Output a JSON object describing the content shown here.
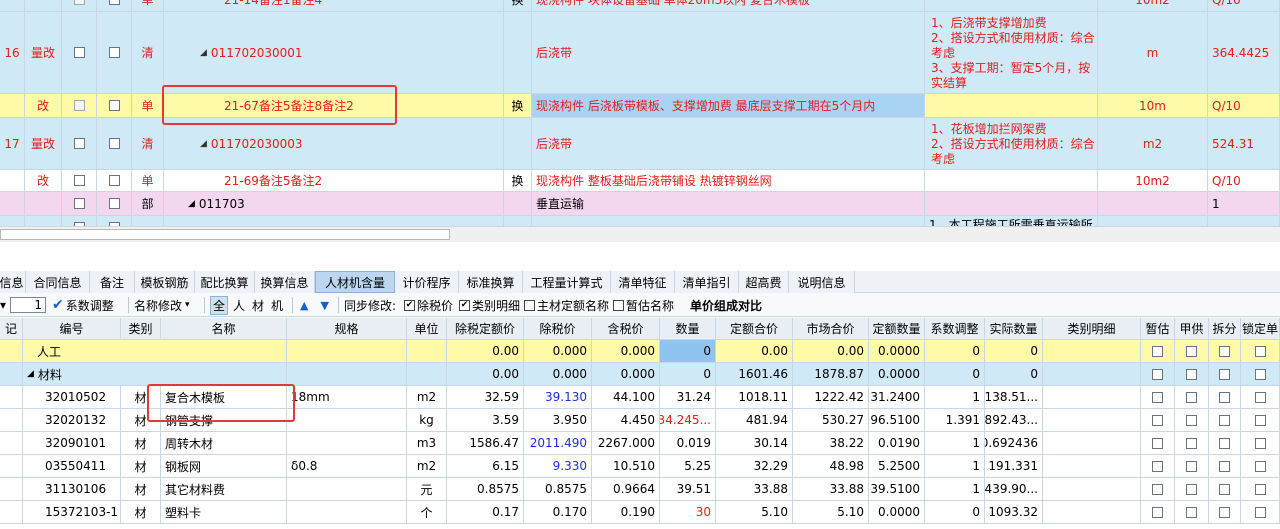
{
  "top_rows": [
    {
      "id": "r0",
      "seq": "",
      "mark": "",
      "cat": "单",
      "code": "21-14备注1备注4",
      "ext": "换",
      "name": "现浇构件 块体设备基础 单体20m3以内 复合木模板",
      "features": "",
      "unit": "10m2",
      "qty": "Q/10"
    },
    {
      "id": "r1",
      "seq": "16",
      "mark": "量改",
      "cat": "清",
      "code": "011702030001",
      "ext": "",
      "name": "后浇带",
      "features": [
        "1、后浇带支撑增加费",
        "2、搭设方式和使用材质：综合考虑",
        "3、支撑工期：暂定5个月，按实结算"
      ],
      "unit": "m",
      "qty": "364.4425"
    },
    {
      "id": "r2",
      "seq": "",
      "mark": "改",
      "cat": "单",
      "code": "21-67备注5备注8备注2",
      "ext": "换",
      "name": "现浇构件 后浇板带模板、支撑增加费 最底层支撑工期在5个月内",
      "features": "",
      "unit": "10m",
      "qty": "Q/10"
    },
    {
      "id": "r3",
      "seq": "17",
      "mark": "量改",
      "cat": "清",
      "code": "011702030003",
      "ext": "",
      "name": "后浇带",
      "features": [
        "1、花板增加拦网架费",
        "2、搭设方式和使用材质：综合考虑"
      ],
      "unit": "m2",
      "qty": "524.31"
    },
    {
      "id": "r4",
      "seq": "",
      "mark": "改",
      "cat": "单",
      "code": "21-69备注5备注2",
      "ext": "换",
      "name": "现浇构件 整板基础后浇带铺设 热镀锌钢丝网",
      "features": "",
      "unit": "10m2",
      "qty": "Q/10"
    },
    {
      "id": "r5",
      "seq": "",
      "mark": "",
      "cat": "部",
      "code": "011703",
      "ext": "",
      "name": "垂直运输",
      "features": "",
      "unit": "",
      "qty": "1"
    },
    {
      "id": "r6",
      "seq": "",
      "mark": "",
      "cat": "",
      "code": "",
      "ext": "",
      "name": "",
      "features": "1、本工程施工所需垂直运输所",
      "unit": "",
      "qty": ""
    }
  ],
  "tabs": [
    "信息",
    "合同信息",
    "备注",
    "模板钢筋",
    "配比换算",
    "换算信息",
    "人材机含量",
    "计价程序",
    "标准换算",
    "工程量计算式",
    "清单特征",
    "清单指引",
    "超高费",
    "说明信息"
  ],
  "active_tab": "人材机含量",
  "toolbar": {
    "spin_value": "1",
    "coef_adjust": "系数调整",
    "name_edit": "名称修改",
    "filters": [
      "全",
      "人",
      "材",
      "机"
    ],
    "sync_label": "同步修改:",
    "checks": [
      {
        "label": "除税价",
        "checked": "✔"
      },
      {
        "label": "类别明细",
        "checked": "✔"
      },
      {
        "label": "主材定额名称",
        "checked": ""
      },
      {
        "label": "暂估名称",
        "checked": ""
      }
    ],
    "compare": "单价组成对比"
  },
  "columns": [
    "记",
    "编号",
    "类别",
    "名称",
    "规格",
    "单位",
    "除税定额价",
    "除税价",
    "含税价",
    "数量",
    "定额合价",
    "市场合价",
    "定额数量",
    "系数调整",
    "实际数量",
    "类别明细",
    "暂估",
    "甲供",
    "拆分",
    "锁定单"
  ],
  "groups": [
    {
      "toggle": "",
      "name": "人工",
      "vals": [
        "0.00",
        "0.000",
        "0.000",
        "0",
        "0.00",
        "0.00",
        "0.0000",
        "0",
        "0"
      ]
    },
    {
      "toggle": "◢",
      "name": "材料",
      "vals": [
        "0.00",
        "0.000",
        "0.000",
        "0",
        "1601.46",
        "1878.87",
        "0.0000",
        "0",
        "0"
      ]
    }
  ],
  "materials": [
    {
      "code": "32010502",
      "type": "材",
      "name": "复合木模板",
      "spec": "18mm",
      "unit": "m2",
      "base": "32.59",
      "price": "39.130",
      "tax": "44.100",
      "qty": "31.24",
      "sum": "1018.11",
      "mkt": "1222.42",
      "dqty": "31.2400",
      "coef": "1",
      "actual": "1138.51..."
    },
    {
      "code": "32020132",
      "type": "材",
      "name": "钢管支撑",
      "spec": "",
      "unit": "kg",
      "base": "3.59",
      "price": "3.950",
      "tax": "4.450",
      "qty": "134.245...",
      "sum": "481.94",
      "mkt": "530.27",
      "dqty": "96.5100",
      "coef": "1.391",
      "actual": "4892.43..."
    },
    {
      "code": "32090101",
      "type": "材",
      "name": "周转木材",
      "spec": "",
      "unit": "m3",
      "base": "1586.47",
      "price": "2011.490",
      "tax": "2267.000",
      "qty": "0.019",
      "sum": "30.14",
      "mkt": "38.22",
      "dqty": "0.0190",
      "coef": "1",
      "actual": "0.692436"
    },
    {
      "code": "03550411",
      "type": "材",
      "name": "钢板网",
      "spec": "δ0.8",
      "unit": "m2",
      "base": "6.15",
      "price": "9.330",
      "tax": "10.510",
      "qty": "5.25",
      "sum": "32.29",
      "mkt": "48.98",
      "dqty": "5.2500",
      "coef": "1",
      "actual": "191.331"
    },
    {
      "code": "31130106",
      "type": "材",
      "name": "其它材料费",
      "spec": "",
      "unit": "元",
      "base": "0.8575",
      "price": "0.8575",
      "tax": "0.9664",
      "qty": "39.51",
      "sum": "33.88",
      "mkt": "33.88",
      "dqty": "39.5100",
      "coef": "1",
      "actual": "1439.90..."
    },
    {
      "code": "15372103-1",
      "type": "材",
      "name": "塑料卡",
      "spec": "",
      "unit": "个",
      "base": "0.17",
      "price": "0.170",
      "tax": "0.190",
      "qty": "30",
      "sum": "5.10",
      "mkt": "5.10",
      "dqty": "0.0000",
      "coef": "0",
      "actual": "1093.32"
    }
  ],
  "colors": {
    "row_blue": "#cfe9f7",
    "row_yellow": "#fffaa8",
    "row_pink": "#f3d7ee",
    "selected": "#8fc3f0",
    "highlight_box": "#e23a3a",
    "active_tab": "#bcd6f0"
  }
}
